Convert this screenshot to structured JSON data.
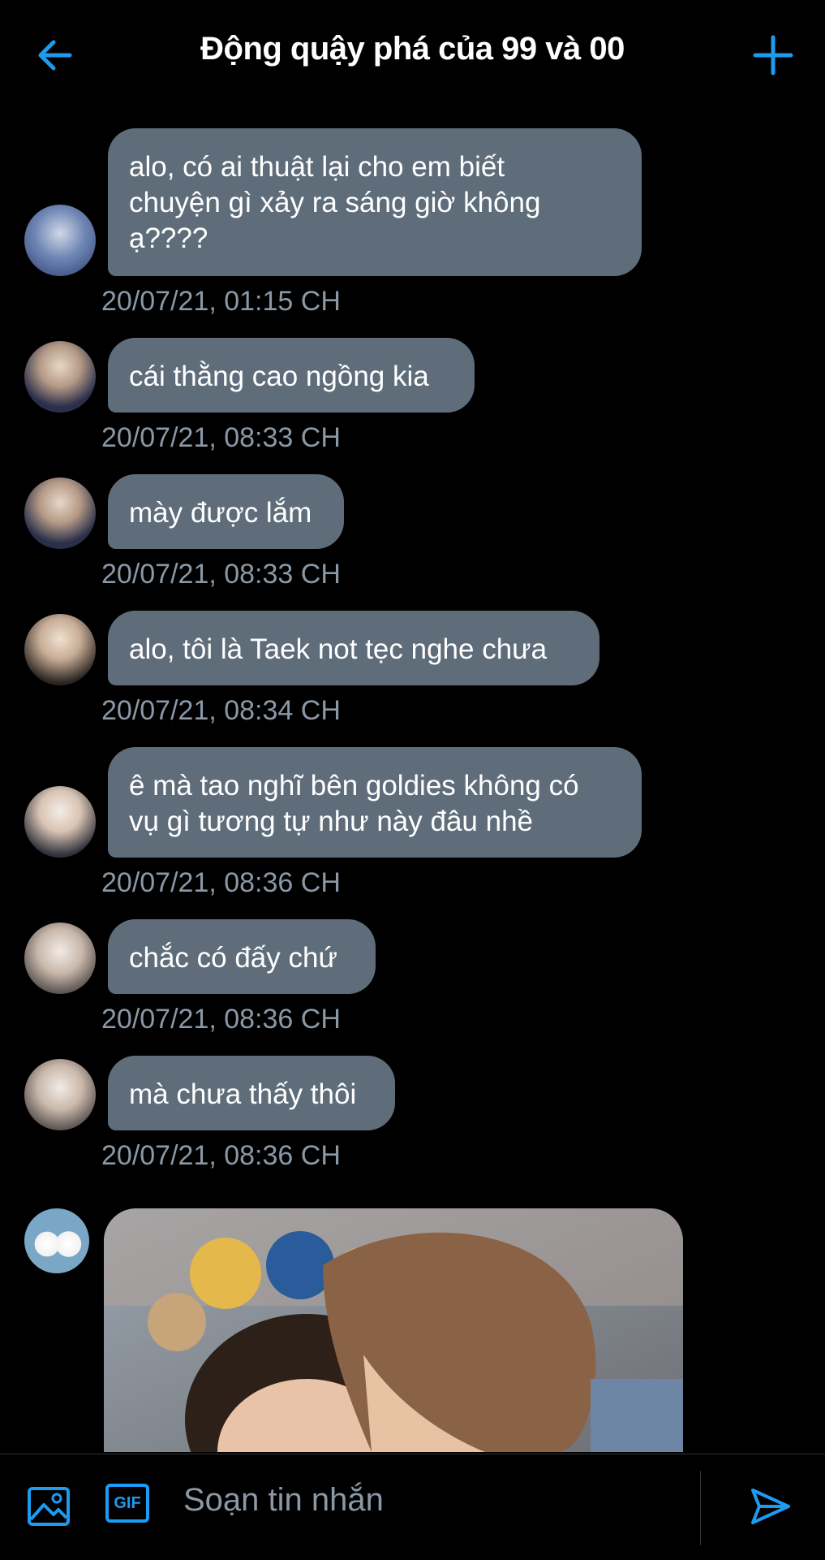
{
  "header": {
    "title": "Động quậy phá của 99 và 00",
    "back_icon": "arrow-left-icon",
    "add_icon": "plus-icon",
    "accent": "#1d9bf0"
  },
  "messages": [
    {
      "text_lines": [
        "alo, có ai thuật lại cho em biết",
        "chuyện gì xảy ra sáng giờ không",
        "ạ????"
      ],
      "time": "20/07/21, 01:15 CH"
    },
    {
      "text_lines": [
        "cái thằng cao ngồng kia"
      ],
      "time": "20/07/21, 08:33 CH"
    },
    {
      "text_lines": [
        "mày được lắm"
      ],
      "time": "20/07/21, 08:33 CH"
    },
    {
      "text_lines": [
        "alo, tôi là Taek not tẹc nghe chưa"
      ],
      "time": "20/07/21, 08:34 CH"
    },
    {
      "text_lines": [
        "ê mà tao nghĩ bên goldies không có",
        "vụ gì tương tự như này đâu nhề"
      ],
      "time": "20/07/21, 08:36 CH"
    },
    {
      "text_lines": [
        "chắc có đấy chứ"
      ],
      "time": "20/07/21, 08:36 CH"
    },
    {
      "text_lines": [
        "mà chưa thấy thôi"
      ],
      "time": "20/07/21, 08:36 CH"
    }
  ],
  "composer": {
    "placeholder": "Soạn tin nhắn",
    "image_icon": "image-icon",
    "gif_label": "GIF",
    "send_icon": "send-icon"
  },
  "colors": {
    "bubble": "#5f6d7b",
    "timestamp": "#8b98a5",
    "background": "#000000"
  }
}
